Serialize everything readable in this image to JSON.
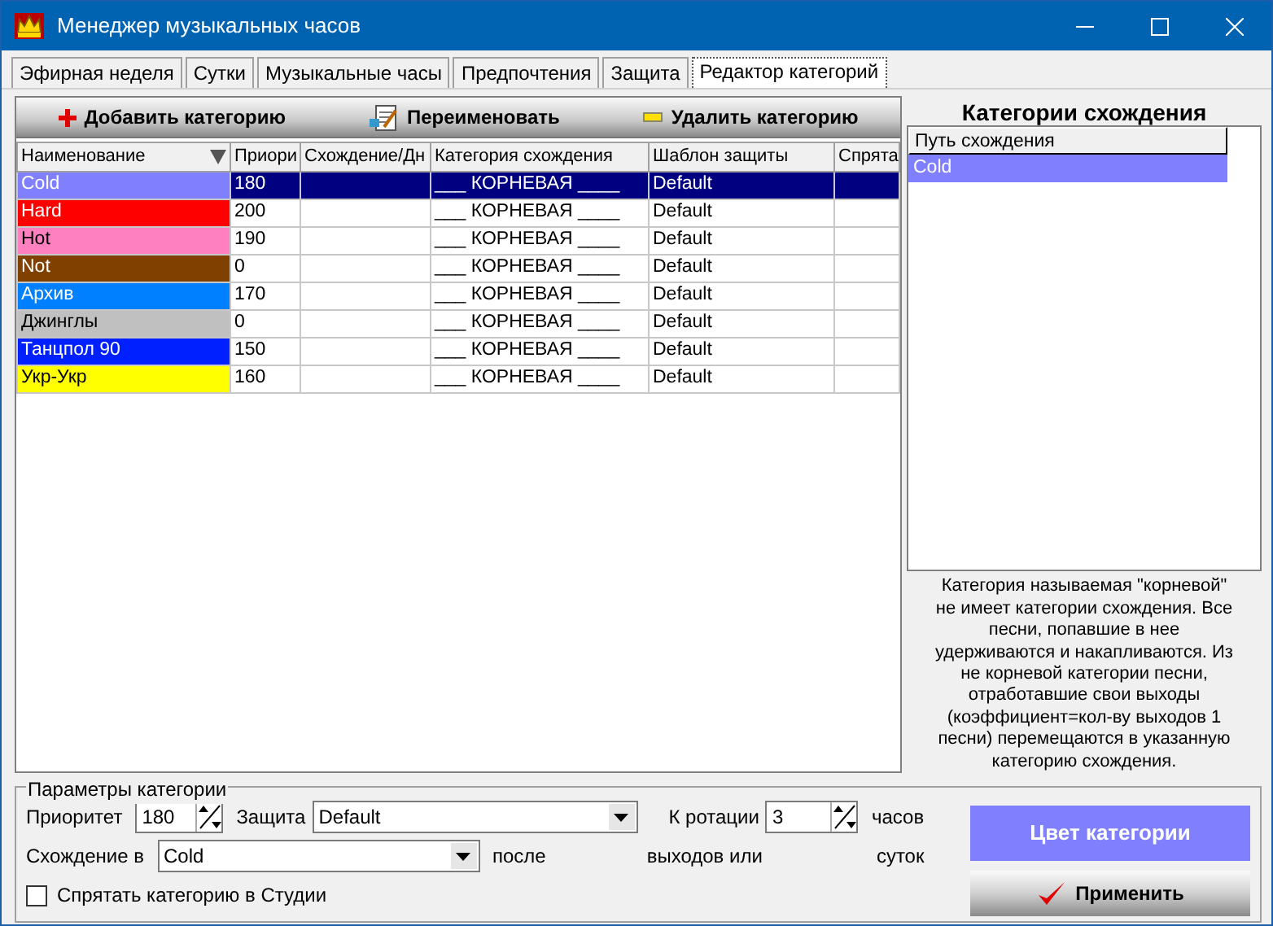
{
  "window": {
    "title": "Менеджер музыкальных часов"
  },
  "tabs": [
    {
      "label": "Эфирная неделя",
      "selected": false
    },
    {
      "label": "Сутки",
      "selected": false
    },
    {
      "label": "Музыкальные часы",
      "selected": false
    },
    {
      "label": "Предпочтения",
      "selected": false
    },
    {
      "label": "Защита",
      "selected": false
    },
    {
      "label": "Редактор категорий",
      "selected": true
    }
  ],
  "toolbar": [
    {
      "kind": "add",
      "label": "Добавить категорию"
    },
    {
      "kind": "rename",
      "label": "Переименовать"
    },
    {
      "kind": "delete",
      "label": "Удалить категорию"
    }
  ],
  "table": {
    "columns": [
      "Наименование",
      "Приори",
      "Схождение/Дн",
      "Категория схождения",
      "Шаблон защиты",
      "Спрята"
    ],
    "rows": [
      {
        "name": "Cold",
        "color": "#8080ff",
        "priority": "180",
        "category": "___ КОРНЕВАЯ ____",
        "template": "Default",
        "selected": true
      },
      {
        "name": "Hard",
        "color": "#ff0000",
        "priority": "200",
        "category": "___ КОРНЕВАЯ ____",
        "template": "Default",
        "selected": false
      },
      {
        "name": "Hot",
        "color": "#ff80c0",
        "priority": "190",
        "category": "___ КОРНЕВАЯ ____",
        "template": "Default",
        "selected": false
      },
      {
        "name": "Not",
        "color": "#804000",
        "priority": "0",
        "category": "___ КОРНЕВАЯ ____",
        "template": "Default",
        "selected": false
      },
      {
        "name": "Архив",
        "color": "#0080ff",
        "priority": "170",
        "category": "___ КОРНЕВАЯ ____",
        "template": "Default",
        "selected": false
      },
      {
        "name": "Джинглы",
        "color": "#c0c0c0",
        "priority": "0",
        "category": "___ КОРНЕВАЯ ____",
        "template": "Default",
        "selected": false
      },
      {
        "name": "Танцпол 90",
        "color": "#0020ff",
        "priority": "150",
        "category": "___ КОРНЕВАЯ ____",
        "template": "Default",
        "selected": false
      },
      {
        "name": "Укр-Укр",
        "color": "#ffff00",
        "priority": "160",
        "category": "___ КОРНЕВАЯ ____",
        "template": "Default",
        "selected": false
      }
    ]
  },
  "convergence": {
    "title": "Категории схождения",
    "column": "Путь схождения",
    "items": [
      {
        "label": "Cold",
        "color": "#8080ff"
      }
    ],
    "note": "Категория называемая \"корневой\" не имеет категории схождения. Все песни, попавшие в нее удерживаются и накапливаются. Из не корневой категории песни, отработавшие свои выходы (коэффициент=кол-ву выходов 1 песни) перемещаются в указанную категорию схождения."
  },
  "params": {
    "title": "Параметры категории",
    "priority_label": "Приоритет",
    "priority": "180",
    "protection_label": "Защита",
    "protection": "Default",
    "rotation_label": "К ротации",
    "rotation": "3",
    "hours_label": "часов",
    "convergence_label": "Схождение в",
    "convergence": "Cold",
    "after_label": "после",
    "outputs_label": "выходов или",
    "days_label": "суток",
    "hide_label": "Спрятать категорию в Студии",
    "hide_checked": false,
    "color_button": {
      "label": "Цвет категории",
      "color": "#8080ff"
    },
    "apply_button": "Применить"
  }
}
